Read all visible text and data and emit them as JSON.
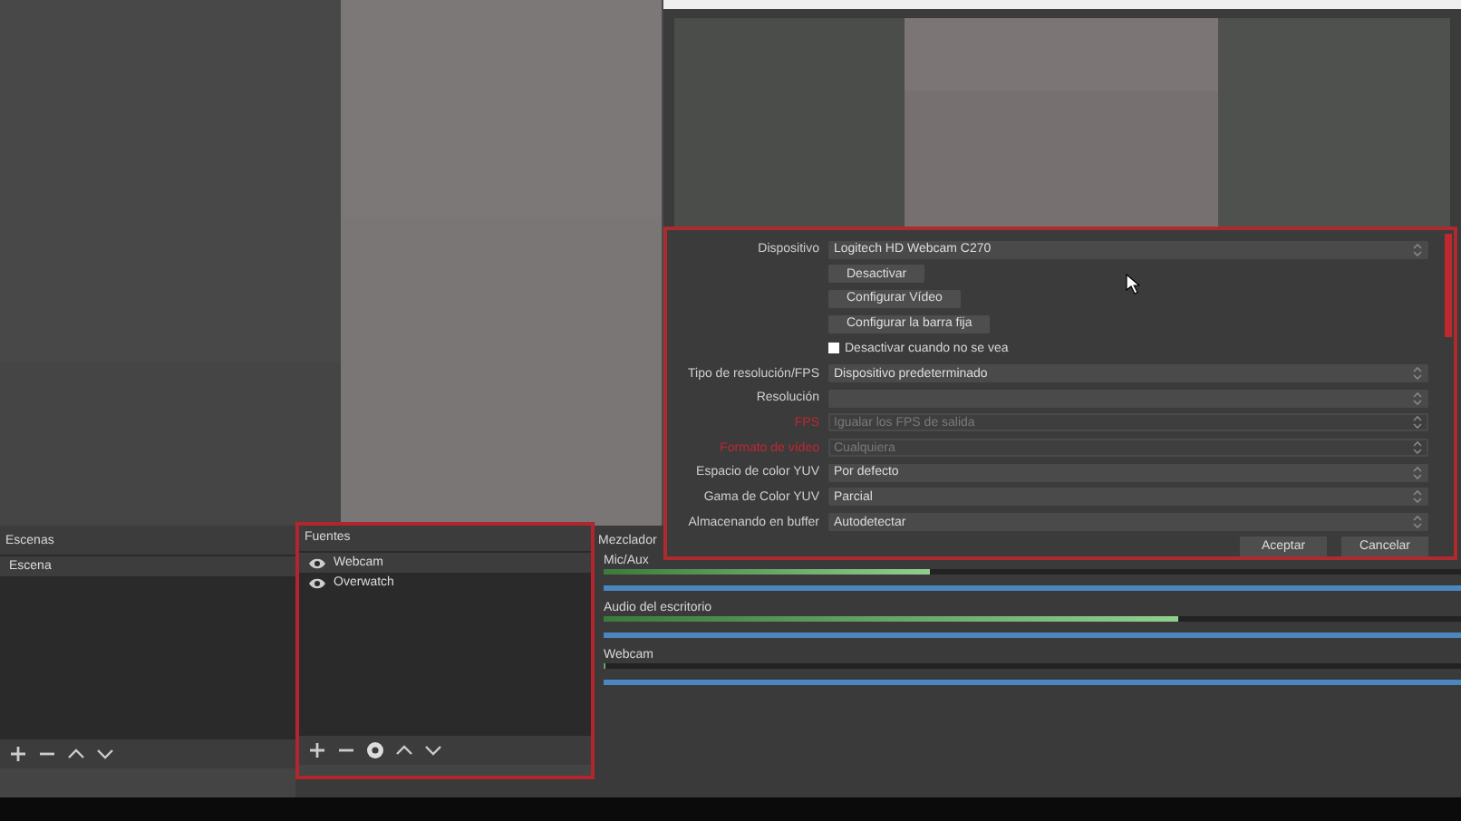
{
  "docks": {
    "scenes": {
      "title": "Escenas",
      "highlighted": false,
      "items": [
        {
          "label": "Escena",
          "selected": true
        }
      ]
    },
    "sources": {
      "title": "Fuentes",
      "highlighted": true,
      "items": [
        {
          "label": "Webcam",
          "selected": true,
          "visible": true
        },
        {
          "label": "Overwatch",
          "selected": false,
          "visible": true
        }
      ]
    },
    "mixer": {
      "title": "Mezclador",
      "channels": [
        {
          "name": "Mic/Aux",
          "meter": {
            "level": 0.38
          },
          "fader": {
            "level": 1
          }
        },
        {
          "name": "Audio del escritorio",
          "meter": {
            "level": 0.67
          },
          "fader": {
            "level": 1
          }
        },
        {
          "name": "Webcam",
          "meter": {
            "level": 0
          },
          "fader": {
            "level": 1
          }
        }
      ]
    }
  },
  "dialog": {
    "highlighted": true,
    "rows": [
      {
        "kind": "select",
        "label": "Dispositivo",
        "value": "Logitech HD Webcam C270",
        "disabled": false,
        "highlighted": false
      },
      {
        "kind": "button",
        "text": "Desactivar"
      },
      {
        "kind": "button",
        "text": "Configurar Vídeo"
      },
      {
        "kind": "button",
        "text": "Configurar la barra fija"
      },
      {
        "kind": "checkbox",
        "text": "Desactivar cuando no se vea",
        "checked": false
      },
      {
        "kind": "select",
        "label": "Tipo de resolución/FPS",
        "value": "Dispositivo predeterminado",
        "disabled": false,
        "highlighted": false
      },
      {
        "kind": "select",
        "label": "Resolución",
        "disabled": false,
        "highlighted": false
      },
      {
        "kind": "select",
        "label": "FPS",
        "value": "Igualar los FPS de salida",
        "disabled": true,
        "highlighted": true
      },
      {
        "kind": "select",
        "label": "Formato de vídeo",
        "value": "Cualquiera",
        "disabled": true,
        "highlighted": true
      },
      {
        "kind": "select",
        "label": "Espacio de color YUV",
        "value": "Por defecto",
        "disabled": false,
        "highlighted": false
      },
      {
        "kind": "select",
        "label": "Gama de Color YUV",
        "value": "Parcial",
        "disabled": false,
        "highlighted": false
      },
      {
        "kind": "select",
        "label": "Almacenando en buffer",
        "value": "Autodetectar",
        "disabled": false,
        "highlighted": false
      }
    ],
    "buttons": [
      "Aceptar",
      "Cancelar"
    ]
  }
}
